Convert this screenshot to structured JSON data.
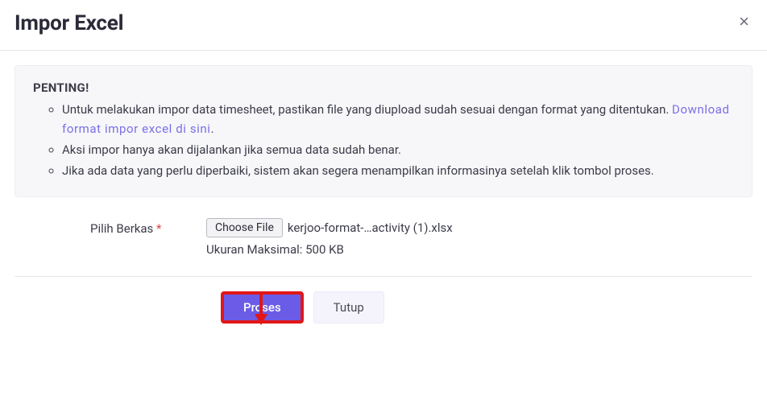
{
  "modal": {
    "title": "Impor Excel",
    "close_label": "×"
  },
  "alert": {
    "title": "PENTING!",
    "items": [
      {
        "text_before": "Untuk melakukan impor data timesheet, pastikan file yang diupload sudah sesuai dengan format yang ditentukan. ",
        "link_text": "Download format impor excel di sini",
        "text_after": "."
      },
      {
        "text_before": "Aksi impor hanya akan dijalankan jika semua data sudah benar.",
        "link_text": "",
        "text_after": ""
      },
      {
        "text_before": "Jika ada data yang perlu diperbaiki, sistem akan segera menampilkan informasinya setelah klik tombol proses.",
        "link_text": "",
        "text_after": ""
      }
    ]
  },
  "form": {
    "file_label": "Pilih Berkas",
    "required_mark": "*",
    "choose_file_label": "Choose File",
    "selected_file_name": "kerjoo-format-…activity (1).xlsx",
    "max_size_text": "Ukuran Maksimal: 500 KB"
  },
  "footer": {
    "process_label": "Proses",
    "close_label": "Tutup"
  },
  "annotation": {
    "arrow_color": "#e11717"
  }
}
